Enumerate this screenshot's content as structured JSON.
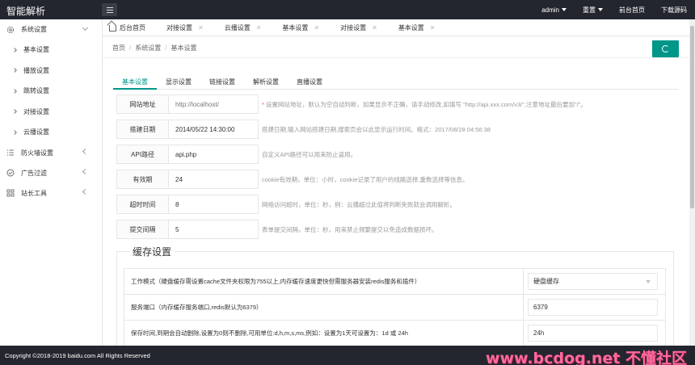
{
  "app": {
    "title": "智能解析"
  },
  "topbar": {
    "user": "admin",
    "reset": "重置",
    "frontend": "前台首页",
    "download": "下载源码"
  },
  "sidebar": {
    "system": "系统设置",
    "sub_items": [
      "基本设置",
      "播放设置",
      "跳转设置",
      "对接设置",
      "云播设置"
    ],
    "firewall": "防火墙设置",
    "ads": "广告过滤",
    "tools": "站长工具"
  },
  "page_tabs": {
    "home": "后台首页",
    "items": [
      "对接设置",
      "云播设置",
      "基本设置",
      "对接设置",
      "基本设置"
    ]
  },
  "breadcrumb": {
    "home": "首页",
    "section": "系统设置",
    "current": "基本设置"
  },
  "content_tabs": [
    "基本设置",
    "显示设置",
    "链接设置",
    "解析设置",
    "直播设置"
  ],
  "form": [
    {
      "label": "网站地址",
      "value": "",
      "placeholder": "http://localhost/",
      "required": true,
      "tip": "设置网站地址，默认为空自动判断，如果显示不正确，请手动修改,如填写 \"http://api.xxx.com/v3/\",注意地址最后要加\"/\"。"
    },
    {
      "label": "搭建日期",
      "value": "2014/05/22 14:30:00",
      "placeholder": "",
      "required": false,
      "tip": "搭建日期,输入网站搭建日期,搜索页会以此显示运行时间。格式：2017/08/28 04:56:38"
    },
    {
      "label": "API路径",
      "value": "api.php",
      "placeholder": "",
      "required": false,
      "tip": "自定义API路径可以用来防止盗用。"
    },
    {
      "label": "有效期",
      "value": "24",
      "placeholder": "",
      "required": false,
      "tip": "cookie有效期，单位：小时，cookie记录了用户的线路选择,重数选择等信息。"
    },
    {
      "label": "超时时间",
      "value": "8",
      "placeholder": "",
      "required": false,
      "tip": "网络访问超时，单位：秒，例：云播超过此值将判断失败就会调用解析。"
    },
    {
      "label": "提交间隔",
      "value": "5",
      "placeholder": "",
      "required": false,
      "tip": "表单提交间隔，单位：秒，用来禁止频繁提交以免造成数据损坏。"
    }
  ],
  "cache": {
    "legend": "缓存设置",
    "rows": [
      {
        "label": "工作模式（硬盘缓存需设置cache文件夹权限为755以上,内存缓存速度更快但需服务器安装redis服务和插件）",
        "value": "硬盘缓存",
        "select": true
      },
      {
        "label": "服务端口（内存缓存服务端口,redis默认为6379）",
        "value": "6379",
        "select": false
      },
      {
        "label": "保存时间,到期会自动删除,设置为0则不删除,可用单位:d,h,m,s,ms,例如：设置为1天可设置为：1d 或 24h",
        "value": "24h",
        "select": false
      }
    ]
  },
  "footer": {
    "copyright": "Copyright ©2018-2019 baidu.com All Rights Reserved",
    "watermark": "www.bcdog.net 不懂社区"
  },
  "colors": {
    "accent": "#009688",
    "topbar": "#23262e",
    "required": "#ff5722",
    "watermark": "#ff6a9e"
  },
  "icons": [
    "menu-icon",
    "gear-icon",
    "chevron-down-icon",
    "chevron-right-icon",
    "chevron-left-icon",
    "list-icon",
    "circle-check-icon",
    "grid-icon",
    "home-icon",
    "close-icon",
    "refresh-icon",
    "caret-down-icon"
  ]
}
